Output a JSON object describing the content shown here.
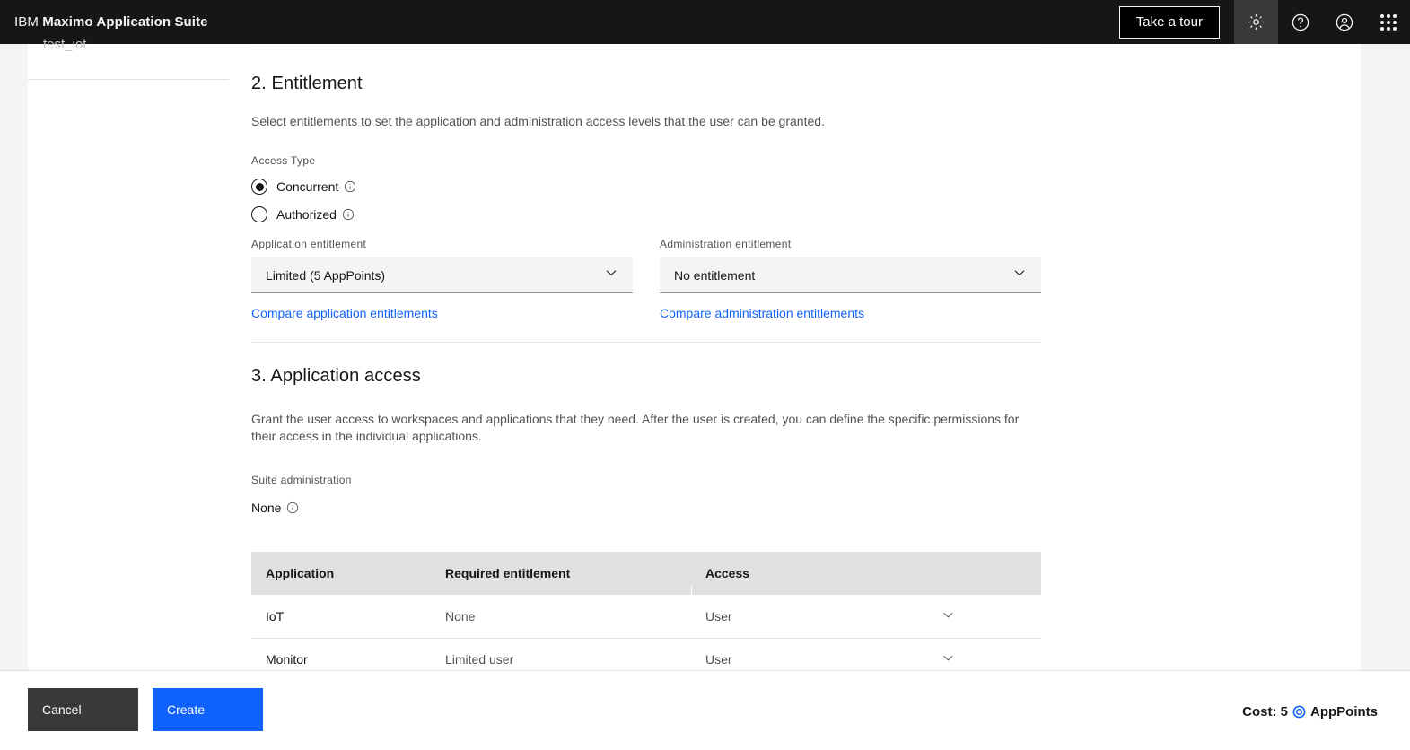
{
  "header": {
    "brand_prefix": "IBM",
    "brand_name": "Maximo Application Suite",
    "tour_button": "Take a tour",
    "icons": {
      "settings": "gear-icon",
      "help": "help-icon",
      "account": "user-avatar-icon",
      "switcher": "app-switcher-icon"
    }
  },
  "sidebar": {
    "item_label": "test_iot"
  },
  "section2": {
    "title": "2. Entitlement",
    "description": "Select entitlements to set the application and administration access levels that the user can be granted.",
    "access_type_label": "Access Type",
    "options": [
      {
        "label": "Concurrent",
        "selected": true
      },
      {
        "label": "Authorized",
        "selected": false
      }
    ],
    "application_entitlement": {
      "label": "Application entitlement",
      "value": "Limited (5 AppPoints)",
      "link": "Compare application entitlements"
    },
    "administration_entitlement": {
      "label": "Administration entitlement",
      "value": "No entitlement",
      "link": "Compare administration entitlements"
    }
  },
  "section3": {
    "title": "3. Application access",
    "description": "Grant the user access to workspaces and applications that they need. After the user is created, you can define the specific permissions for their access in the individual applications.",
    "suite_administration_label": "Suite administration",
    "suite_administration_value": "None",
    "table": {
      "columns": [
        "Application",
        "Required entitlement",
        "Access",
        ""
      ],
      "rows": [
        {
          "application": "IoT",
          "required_entitlement": "None",
          "access": "User"
        },
        {
          "application": "Monitor",
          "required_entitlement": "Limited user",
          "access": "User"
        }
      ]
    }
  },
  "footer": {
    "cancel_label": "Cancel",
    "create_label": "Create",
    "cost_prefix": "Cost: 5",
    "cost_suffix": "AppPoints"
  },
  "colors": {
    "accent_blue": "#0f62fe",
    "header_black": "#161616",
    "cancel_gray": "#393939",
    "table_header_gray": "#e0e0e0"
  }
}
